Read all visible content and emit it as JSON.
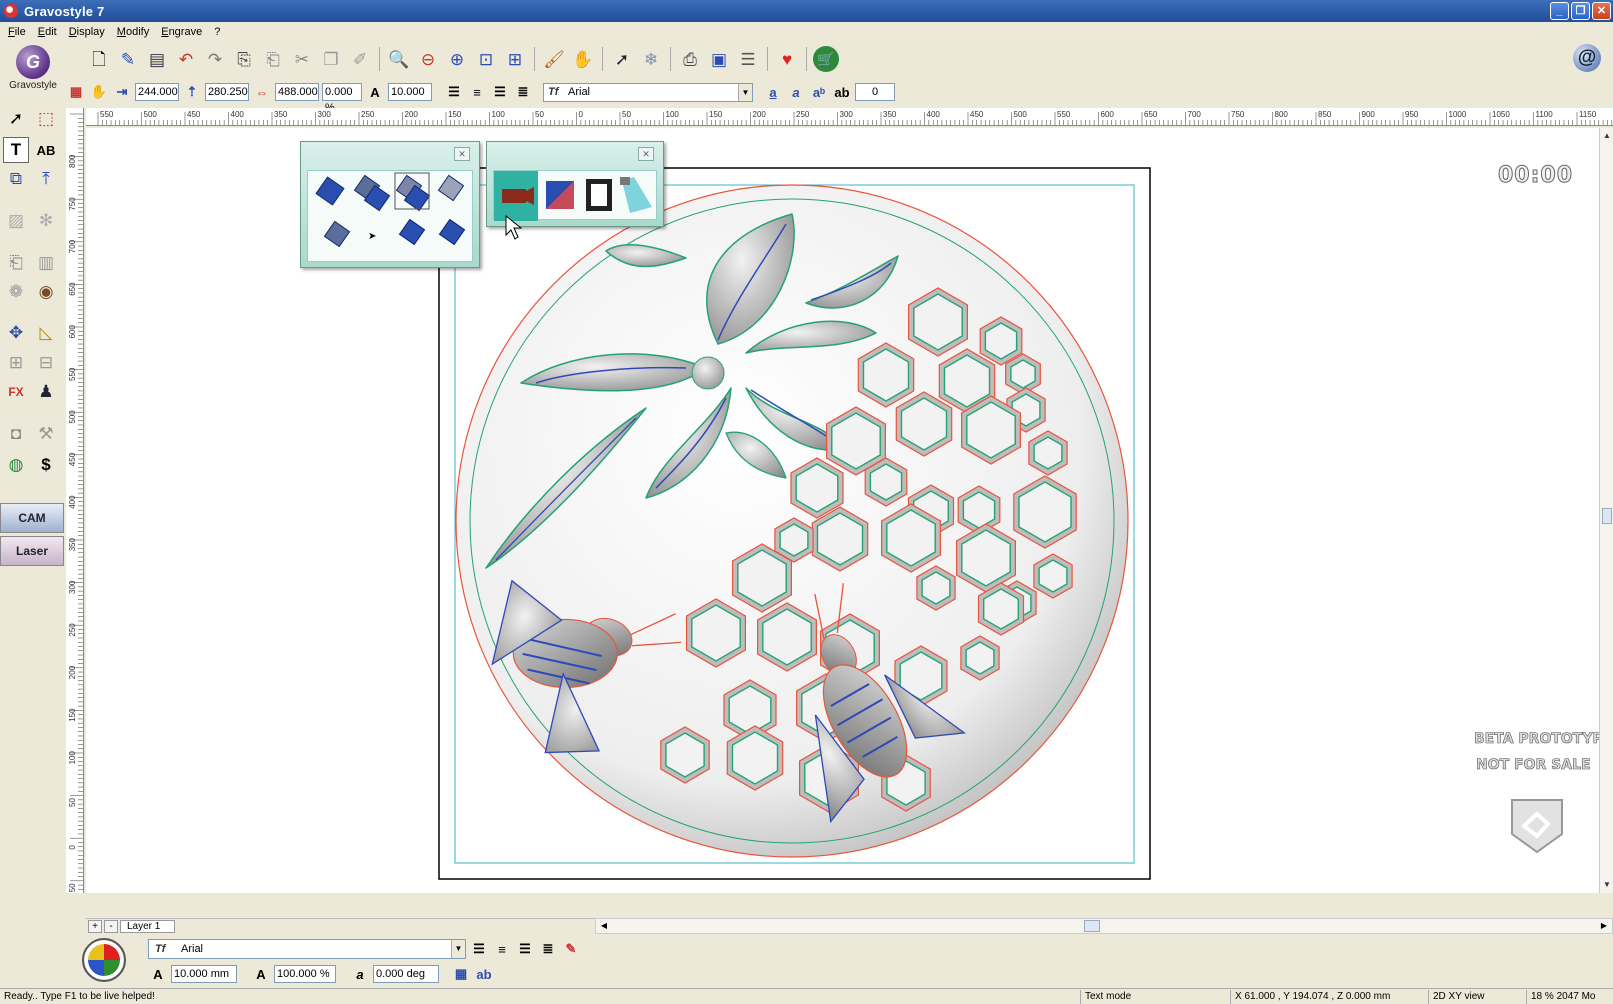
{
  "window": {
    "title": "Gravostyle 7",
    "buttons": {
      "minimize": "_",
      "restore": "❐",
      "close": "✕"
    }
  },
  "menu": [
    "File",
    "Edit",
    "Display",
    "Modify",
    "Engrave",
    "?"
  ],
  "logo": {
    "name": "Gravostyle"
  },
  "toolbar": {
    "icons": [
      "new-document-icon",
      "pen-icon",
      "save-icon",
      "undo-icon",
      "redo-icon",
      "import-icon",
      "export-icon",
      "cut-icon",
      "copy-icon",
      "paste-icon",
      "zoom-in-icon",
      "zoom-out-icon",
      "zoom-selection-icon",
      "zoom-page-icon",
      "zoom-all-icon",
      "brush-icon",
      "hand-icon",
      "select-arrow-icon",
      "snowflake-icon",
      "printer-icon",
      "machine-icon",
      "settings-list-icon",
      "heart-icon",
      "cart-icon",
      "email-at-icon"
    ]
  },
  "props": {
    "x_value": "244.000",
    "y_value": "280.250",
    "width_value": "488.000",
    "scale_value": "0.000 %",
    "height_value": "10.000",
    "font_name": "Arial",
    "spacing_value": "0"
  },
  "ruler": {
    "h_labels": [
      "550",
      "500",
      "450",
      "400",
      "350",
      "300",
      "250",
      "200",
      "150",
      "100",
      "50",
      "0",
      "50",
      "100",
      "150",
      "200",
      "250",
      "300",
      "350",
      "400",
      "450",
      "500",
      "550",
      "600",
      "650",
      "700",
      "750",
      "800",
      "850",
      "900",
      "950",
      "1000",
      "1050",
      "1100",
      "1150"
    ],
    "v_labels": [
      "800",
      "750",
      "700",
      "650",
      "600",
      "550",
      "500",
      "450",
      "400",
      "350",
      "300",
      "250",
      "200",
      "150",
      "100",
      "50",
      "0",
      "50"
    ]
  },
  "canvas": {
    "timer": "00:00",
    "watermark_line1": "BETA PROTOTYPE",
    "watermark_line2": "NOT FOR SALE"
  },
  "layer": {
    "add": "+",
    "remove": "-",
    "name": "Layer 1"
  },
  "bottom": {
    "font_name": "Arial",
    "height": "10.000 mm",
    "width_percent": "100.000 %",
    "angle": "0.000 deg"
  },
  "status": {
    "message": "Ready.. Type F1 to be live helped!",
    "mode": "Text mode",
    "coords": "X 61.000 , Y 194.074 , Z 0.000 mm",
    "view": "2D XY view",
    "zoom_memory": "18 % 2047 Mo"
  },
  "colors": {
    "title_bar": "#2a5aa8",
    "panel": "#ece9d8",
    "outline_red": "#e8553b",
    "outline_green": "#23a372",
    "outline_blue": "#2f49b8"
  }
}
